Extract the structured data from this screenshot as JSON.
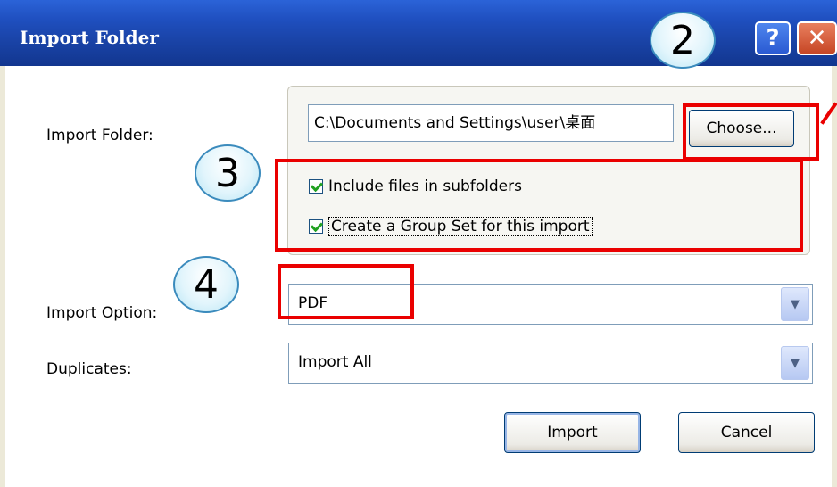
{
  "window": {
    "title": "Import Folder",
    "help_label": "?",
    "close_label": "✕"
  },
  "form": {
    "folder_label": "Import Folder:",
    "folder_path": "C:\\Documents and Settings\\user\\桌面",
    "choose_label": "Choose...",
    "include_subfolders_label": "Include files in subfolders",
    "include_subfolders_checked": true,
    "create_group_set_label": "Create a Group Set for this import",
    "create_group_set_checked": true,
    "import_option_label": "Import Option:",
    "import_option_value": "PDF",
    "duplicates_label": "Duplicates:",
    "duplicates_value": "Import All"
  },
  "buttons": {
    "import_label": "Import",
    "cancel_label": "Cancel"
  },
  "annotations": {
    "callout_2": "2",
    "callout_3": "3",
    "callout_4": "4",
    "highlight_color": "#ea0000",
    "callout_border_color": "#3b8bbd"
  },
  "icons": {
    "dropdown_arrow": "chevron-down-icon",
    "checkbox": "checkmark-icon"
  }
}
